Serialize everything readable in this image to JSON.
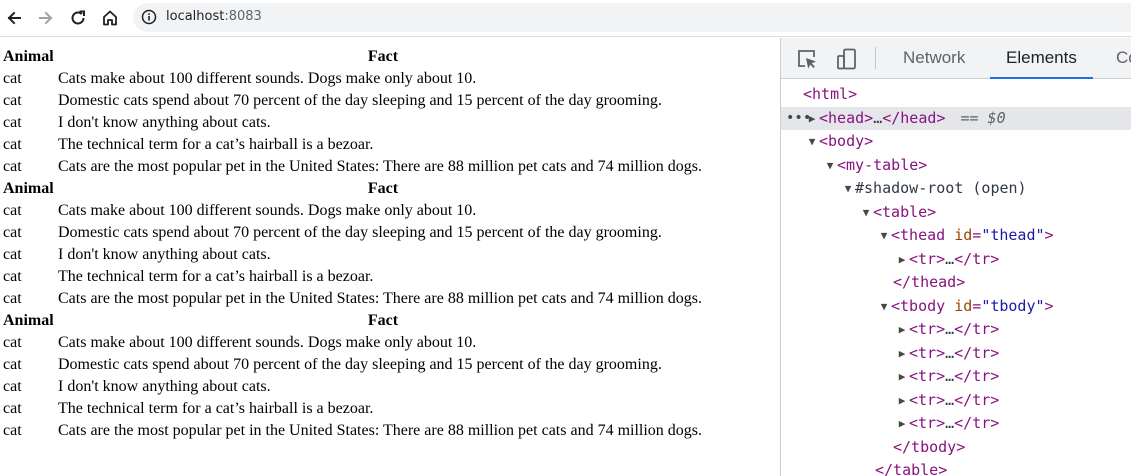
{
  "browser": {
    "url_host": "localhost",
    "url_port": ":8083",
    "icons": [
      "back-arrow-icon",
      "forward-arrow-icon",
      "reload-icon",
      "home-icon",
      "info-icon"
    ]
  },
  "tables": [
    {
      "headers": [
        "Animal",
        "Fact"
      ],
      "rows": [
        [
          "cat",
          "Cats make about 100 different sounds. Dogs make only about 10."
        ],
        [
          "cat",
          "Domestic cats spend about 70 percent of the day sleeping and 15 percent of the day grooming."
        ],
        [
          "cat",
          "I don't know anything about cats."
        ],
        [
          "cat",
          "The technical term for a cat’s hairball is a bezoar."
        ],
        [
          "cat",
          "Cats are the most popular pet in the United States: There are 88 million pet cats and 74 million dogs."
        ]
      ]
    },
    {
      "headers": [
        "Animal",
        "Fact"
      ],
      "rows": [
        [
          "cat",
          "Cats make about 100 different sounds. Dogs make only about 10."
        ],
        [
          "cat",
          "Domestic cats spend about 70 percent of the day sleeping and 15 percent of the day grooming."
        ],
        [
          "cat",
          "I don't know anything about cats."
        ],
        [
          "cat",
          "The technical term for a cat’s hairball is a bezoar."
        ],
        [
          "cat",
          "Cats are the most popular pet in the United States: There are 88 million pet cats and 74 million dogs."
        ]
      ]
    },
    {
      "headers": [
        "Animal",
        "Fact"
      ],
      "rows": [
        [
          "cat",
          "Cats make about 100 different sounds. Dogs make only about 10."
        ],
        [
          "cat",
          "Domestic cats spend about 70 percent of the day sleeping and 15 percent of the day grooming."
        ],
        [
          "cat",
          "I don't know anything about cats."
        ],
        [
          "cat",
          "The technical term for a cat’s hairball is a bezoar."
        ],
        [
          "cat",
          "Cats are the most popular pet in the United States: There are 88 million pet cats and 74 million dogs."
        ]
      ]
    }
  ],
  "devtools": {
    "tabs": [
      "Network",
      "Elements",
      "Co"
    ],
    "active_tab": "Elements",
    "icons": [
      "inspect-element-icon",
      "device-toolbar-icon"
    ],
    "accent_color": "#1a73e8",
    "dom": {
      "html_open": "<html>",
      "head_open": "<head>",
      "head_ellipsis": "…",
      "head_close": "</head>",
      "selected_suffix": "== $0",
      "body_open": "<body>",
      "my_table_open": "<my-table>",
      "shadow_root": "#shadow-root (open)",
      "table_open": "<table>",
      "thead_tag": "<thead",
      "thead_attr_name": "id",
      "thead_attr_value": "\"thead\"",
      "tr_collapsed_open": "<tr>",
      "tr_collapsed_ellipsis": "…",
      "tr_collapsed_close": "</tr>",
      "thead_close": "</thead>",
      "tbody_tag": "<tbody",
      "tbody_attr_name": "id",
      "tbody_attr_value": "\"tbody\"",
      "tbody_close": "</tbody>",
      "table_close": "</table>",
      "gt": ">",
      "eq": "="
    }
  }
}
